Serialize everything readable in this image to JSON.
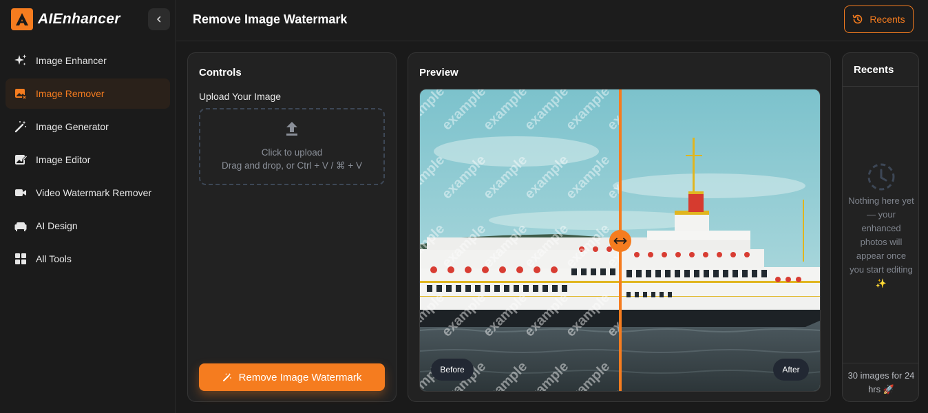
{
  "brand": {
    "name": "AIEnhancer"
  },
  "sidebar": {
    "items": [
      {
        "label": "Image Enhancer",
        "icon": "sparkles-icon",
        "active": false
      },
      {
        "label": "Image Remover",
        "icon": "image-remove-icon",
        "active": true
      },
      {
        "label": "Image Generator",
        "icon": "magic-wand-icon",
        "active": false
      },
      {
        "label": "Image Editor",
        "icon": "image-edit-icon",
        "active": false
      },
      {
        "label": "Video Watermark Remover",
        "icon": "video-camera-icon",
        "active": false
      },
      {
        "label": "AI Design",
        "icon": "sofa-icon",
        "active": false
      },
      {
        "label": "All Tools",
        "icon": "grid-icon",
        "active": false
      }
    ]
  },
  "header": {
    "title": "Remove Image Watermark",
    "recents_label": "Recents"
  },
  "controls": {
    "title": "Controls",
    "upload_label": "Upload Your Image",
    "dropzone_line1": "Click to upload",
    "dropzone_line2": "Drag and drop, or Ctrl + V / ⌘ + V",
    "action_label": "Remove Image Watermark"
  },
  "preview": {
    "title": "Preview",
    "before_label": "Before",
    "after_label": "After",
    "watermark_text": "example"
  },
  "recents": {
    "title": "Recents",
    "empty_text": "Nothing here yet — your enhanced photos will appear once you start editing ✨",
    "quota_text": "30 images for 24 hrs 🚀"
  },
  "colors": {
    "accent": "#f57c1f",
    "background": "#1a1a1a",
    "panel": "#222222"
  }
}
